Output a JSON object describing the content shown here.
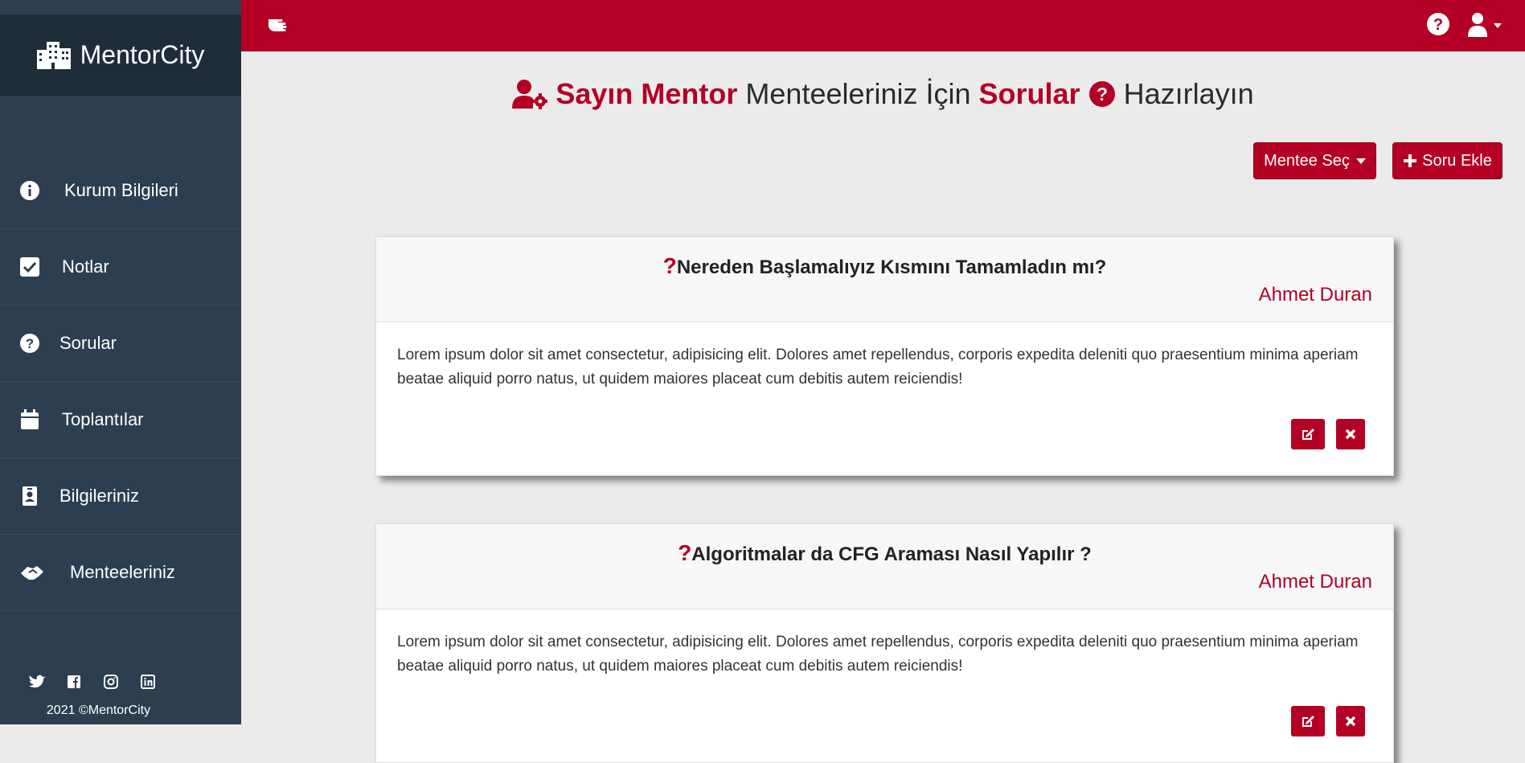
{
  "brand": {
    "name": "MentorCity",
    "icon": "city-icon"
  },
  "nav": [
    {
      "label": "Kurum Bilgileri",
      "icon": "info-circle-icon"
    },
    {
      "label": "Notlar",
      "icon": "check-square-icon"
    },
    {
      "label": "Sorular",
      "icon": "question-circle-icon"
    },
    {
      "label": "Toplantılar",
      "icon": "calendar-icon"
    },
    {
      "label": "Bilgileriniz",
      "icon": "id-badge-icon"
    },
    {
      "label": "Menteeleriniz",
      "icon": "handshake-icon"
    }
  ],
  "footer": {
    "social": [
      "twitter-icon",
      "facebook-icon",
      "instagram-icon",
      "linkedin-icon"
    ],
    "copyright": "2021 ©MentorCity"
  },
  "topbar": {
    "toggle_icon": "hand-pointer-icon",
    "help_icon": "question-circle-icon",
    "user_icon": "user-icon"
  },
  "heading": {
    "part1": "Sayın Mentor",
    "part2": "Menteeleriniz İçin",
    "part3": "Sorular",
    "part4": "Hazırlayın"
  },
  "actions": {
    "mentee_select": "Mentee Seç",
    "add_question": "Soru Ekle"
  },
  "questions": [
    {
      "mark": "?",
      "title": "Nereden Başlamalıyız Kısmını Tamamladın mı?",
      "author": "Ahmet Duran",
      "body": "Lorem ipsum dolor sit amet consectetur, adipisicing elit. Dolores amet repellendus, corporis expedita deleniti quo praesentium minima aperiam beatae aliquid porro natus, ut quidem maiores placeat cum debitis autem reiciendis!"
    },
    {
      "mark": "?",
      "title": "Algoritmalar da CFG Araması Nasıl Yapılır ?",
      "author": "Ahmet Duran",
      "body": "Lorem ipsum dolor sit amet consectetur, adipisicing elit. Dolores amet repellendus, corporis expedita deleniti quo praesentium minima aperiam beatae aliquid porro natus, ut quidem maiores placeat cum debitis autem reiciendis!"
    }
  ],
  "colors": {
    "accent": "#b30024",
    "sidebar": "#2d3e50",
    "brand_bg": "#1f2d3b",
    "page_bg": "#ebebeb"
  }
}
